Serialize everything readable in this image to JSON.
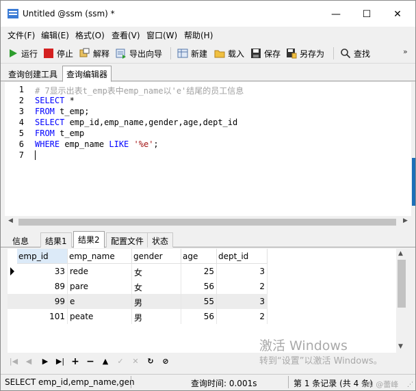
{
  "window": {
    "title": "Untitled @ssm (ssm) *"
  },
  "menu": [
    "文件(F)",
    "编辑(E)",
    "格式(O)",
    "查看(V)",
    "窗口(W)",
    "帮助(H)"
  ],
  "toolbar": {
    "run": "运行",
    "stop": "停止",
    "explain": "解释",
    "export_wizard": "导出向导",
    "new": "新建",
    "load": "载入",
    "save": "保存",
    "save_as": "另存为",
    "find": "查找"
  },
  "editor_tabs": [
    "查询创建工具",
    "查询编辑器"
  ],
  "editor": {
    "lines": [
      {
        "num": "1",
        "text": "# 7显示出表t_emp表中emp_name以'e'结尾的员工信息"
      },
      {
        "num": "2",
        "kw": "SELECT",
        "rest": " *"
      },
      {
        "num": "3",
        "kw": "FROM",
        "rest": " t_emp;"
      },
      {
        "num": "4",
        "kw": "SELECT",
        "rest": " emp_id,emp_name,gender,age,dept_id"
      },
      {
        "num": "5",
        "kw": "FROM",
        "rest": " t_emp"
      },
      {
        "num": "6",
        "kw": "WHERE",
        "mid": " emp_name ",
        "kw2": "LIKE",
        "space": " ",
        "str": "'%e'",
        "end": ";"
      },
      {
        "num": "7"
      }
    ]
  },
  "result_tabs": [
    "信息",
    "结果1",
    "结果2",
    "配置文件",
    "状态"
  ],
  "grid": {
    "columns": [
      "emp_id",
      "emp_name",
      "gender",
      "age",
      "dept_id"
    ],
    "rows": [
      [
        "33",
        "rede",
        "女",
        "25",
        "3"
      ],
      [
        "89",
        "pare",
        "女",
        "56",
        "2"
      ],
      [
        "99",
        "e",
        "男",
        "55",
        "3"
      ],
      [
        "101",
        "peate",
        "男",
        "56",
        "2"
      ]
    ]
  },
  "watermark": {
    "line1": "激活 Windows",
    "line2": "转到“设置”以激活 Windows。"
  },
  "navigator": {
    "first": "|◀",
    "prev": "◀",
    "next": "▶",
    "last": "▶|",
    "add": "+",
    "delete": "−",
    "apply": "▲",
    "confirm": "✓",
    "cancel": "✕",
    "refresh": "↻",
    "stop": "⊘"
  },
  "status": {
    "sql": "SELECT emp_id,emp_name,gen",
    "query_time": "查询时间: 0.001s",
    "record": "第 1 条记录 (共 4 条)",
    "overlay": "DN @蕾峰"
  },
  "win_controls": {
    "min": "—",
    "max": "☐",
    "close": "✕"
  }
}
